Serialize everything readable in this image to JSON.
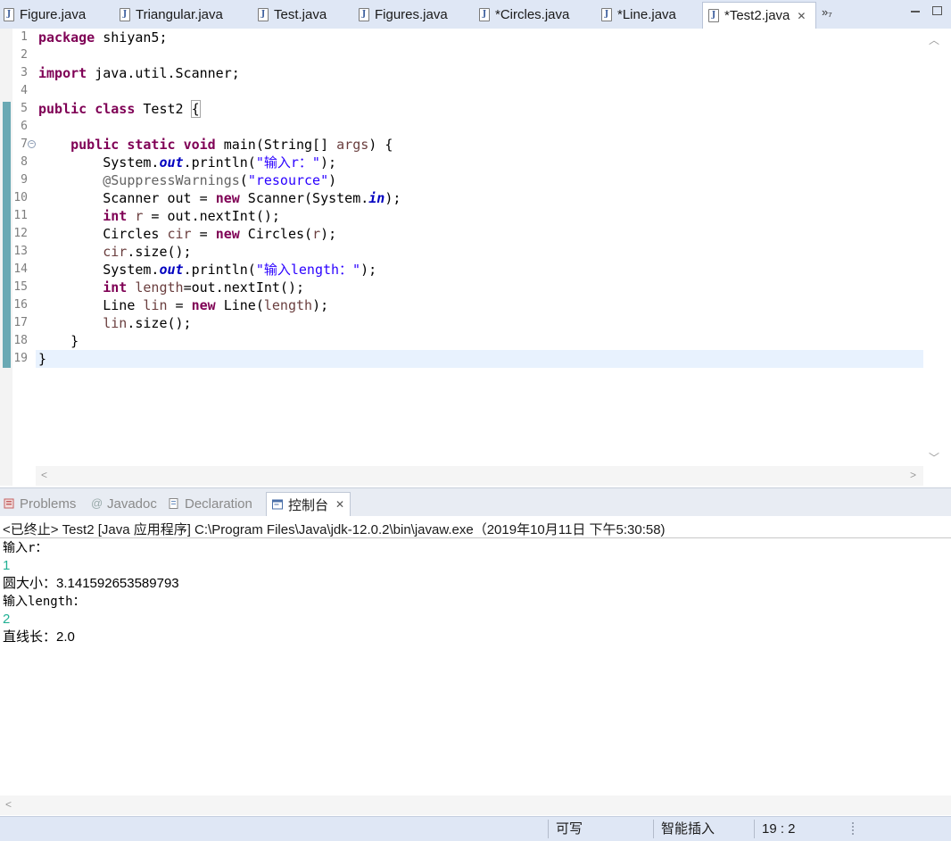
{
  "editor_tabs": [
    {
      "label": "Figure.java",
      "active": false
    },
    {
      "label": "Triangular.java",
      "active": false
    },
    {
      "label": "Test.java",
      "active": false
    },
    {
      "label": "Figures.java",
      "active": false
    },
    {
      "label": "*Circles.java",
      "active": false
    },
    {
      "label": "*Line.java",
      "active": false
    },
    {
      "label": "*Test2.java",
      "active": true
    }
  ],
  "tab_overflow": "»₇",
  "code_lines": [
    {
      "n": "1",
      "text": "package shiyan5;"
    },
    {
      "n": "2",
      "text": ""
    },
    {
      "n": "3",
      "text": "import java.util.Scanner;"
    },
    {
      "n": "4",
      "text": ""
    },
    {
      "n": "5",
      "text": "public class Test2 {"
    },
    {
      "n": "6",
      "text": ""
    },
    {
      "n": "7",
      "text": "    public static void main(String[] args) {"
    },
    {
      "n": "8",
      "text": "        System.out.println(\"输入r：\");"
    },
    {
      "n": "9",
      "text": "        @SuppressWarnings(\"resource\")"
    },
    {
      "n": "10",
      "text": "        Scanner out = new Scanner(System.in);"
    },
    {
      "n": "11",
      "text": "        int r = out.nextInt();"
    },
    {
      "n": "12",
      "text": "        Circles cir = new Circles(r);"
    },
    {
      "n": "13",
      "text": "        cir.size();"
    },
    {
      "n": "14",
      "text": "        System.out.println(\"输入length：\");"
    },
    {
      "n": "15",
      "text": "        int length=out.nextInt();"
    },
    {
      "n": "16",
      "text": "        Line lin = new Line(length);"
    },
    {
      "n": "17",
      "text": "        lin.size();"
    },
    {
      "n": "18",
      "text": "    }"
    },
    {
      "n": "19",
      "text": "}"
    }
  ],
  "view_tabs": [
    {
      "label": "Problems",
      "icon": "problems-icon",
      "active": false
    },
    {
      "label": "Javadoc",
      "icon": "at-icon",
      "active": false
    },
    {
      "label": "Declaration",
      "icon": "declaration-icon",
      "active": false
    },
    {
      "label": "控制台",
      "icon": "console-icon",
      "active": true
    }
  ],
  "console": {
    "header": "<已终止> Test2 [Java 应用程序] C:\\Program Files\\Java\\jdk-12.0.2\\bin\\javaw.exe（2019年10月11日 下午5:30:58)",
    "lines": [
      {
        "text": "输入r：",
        "type": "out"
      },
      {
        "text": "1",
        "type": "in"
      },
      {
        "text": "圆大小：3.141592653589793",
        "type": "out"
      },
      {
        "text": "输入length：",
        "type": "out"
      },
      {
        "text": "2",
        "type": "in"
      },
      {
        "text": "直线长：2.0",
        "type": "out"
      }
    ]
  },
  "status": {
    "writable": "可写",
    "insert_mode": "智能插入",
    "position": "19 : 2"
  },
  "colors": {
    "keyword": "#7f0055",
    "string": "#2a00ff",
    "field": "#0000c0",
    "console_input": "#21b094",
    "current_line": "#e8f2fe",
    "change_bar": "#6aa9b4"
  }
}
